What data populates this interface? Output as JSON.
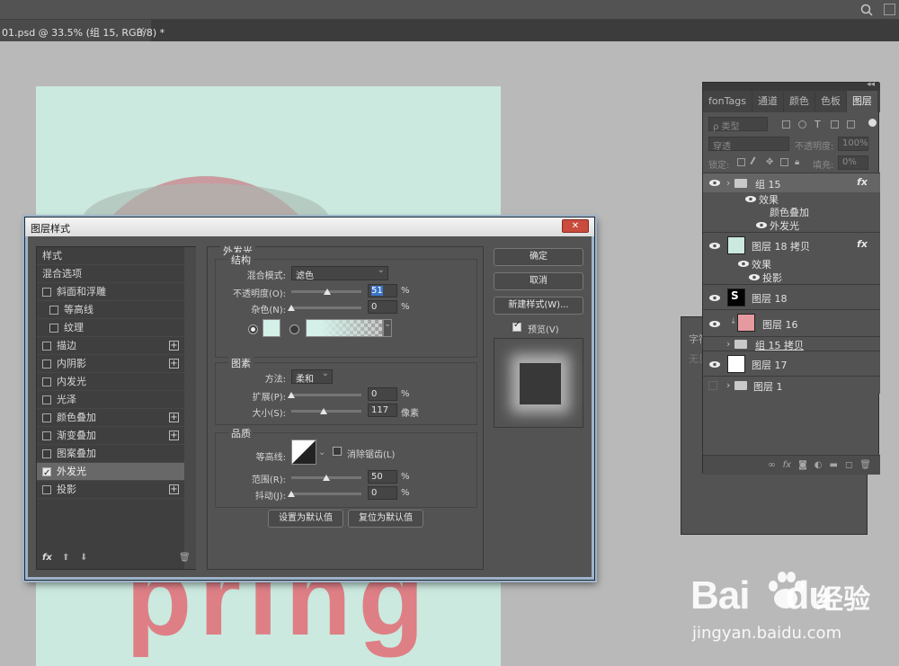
{
  "document_tab": {
    "title": "01.psd @ 33.5% (组 15, RGB/8) *",
    "close": "×"
  },
  "canvas_text": "pring",
  "layers_panel": {
    "collapse": "◂◂",
    "tabs": [
      "fonTags",
      "通道",
      "颜色",
      "色板",
      "图层"
    ],
    "active_tab": "图层",
    "filter_placeholder": "ρ 类型",
    "blend_mode": "穿透",
    "opacity_label": "不透明度:",
    "opacity_value": "100%",
    "lock_label": "锁定:",
    "fill_label": "填充:",
    "fill_value": "0%",
    "layers": [
      {
        "name": "组 15",
        "type": "group",
        "fx": "fx",
        "selected": true
      },
      {
        "name": "效果",
        "type": "effects"
      },
      {
        "name": "颜色叠加",
        "type": "effect"
      },
      {
        "name": "外发光",
        "type": "effect"
      },
      {
        "name": "图层 18 拷贝",
        "type": "layer",
        "fx": "fx"
      },
      {
        "name": "效果",
        "type": "effects"
      },
      {
        "name": "投影",
        "type": "effect"
      },
      {
        "name": "图层 18",
        "type": "layer"
      },
      {
        "name": "图层 16",
        "type": "layer"
      },
      {
        "name": "组 15 拷贝",
        "type": "group"
      },
      {
        "name": "图层 17",
        "type": "layer"
      },
      {
        "name": "图层 1",
        "type": "group"
      }
    ],
    "footer_icons": [
      "link-icon",
      "fx-icon",
      "mask-icon",
      "adjustment-icon",
      "folder-icon",
      "new-layer-icon",
      "trash-icon"
    ]
  },
  "char_panel": {
    "title": "字符",
    "text": "无贝"
  },
  "dialog": {
    "title": "图层样式",
    "styles": [
      {
        "label": "样式",
        "checkbox": false
      },
      {
        "label": "混合选项",
        "checkbox": false
      },
      {
        "label": "斜面和浮雕",
        "checkbox": true,
        "checked": false
      },
      {
        "label": "等高线",
        "checkbox": true,
        "checked": false,
        "indent": true
      },
      {
        "label": "纹理",
        "checkbox": true,
        "checked": false,
        "indent": true
      },
      {
        "label": "描边",
        "checkbox": true,
        "checked": false,
        "plus": true
      },
      {
        "label": "内阴影",
        "checkbox": true,
        "checked": false,
        "plus": true
      },
      {
        "label": "内发光",
        "checkbox": true,
        "checked": false
      },
      {
        "label": "光泽",
        "checkbox": true,
        "checked": false
      },
      {
        "label": "颜色叠加",
        "checkbox": true,
        "checked": false,
        "plus": true
      },
      {
        "label": "渐变叠加",
        "checkbox": true,
        "checked": false,
        "plus": true
      },
      {
        "label": "图案叠加",
        "checkbox": true,
        "checked": false
      },
      {
        "label": "外发光",
        "checkbox": true,
        "checked": true,
        "active": true
      },
      {
        "label": "投影",
        "checkbox": true,
        "checked": false,
        "plus": true
      }
    ],
    "section_title": "外发光",
    "structure": {
      "title": "结构",
      "blend_label": "混合模式:",
      "blend_value": "滤色",
      "opacity_label": "不透明度(O):",
      "opacity_value": "51",
      "opacity_fraction": 0.51,
      "noise_label": "杂色(N):",
      "noise_value": "0",
      "noise_fraction": 0,
      "unit": "%",
      "glow_color": "#d4f0e8"
    },
    "elements": {
      "title": "图素",
      "method_label": "方法:",
      "method_value": "柔和",
      "spread_label": "扩展(P):",
      "spread_value": "0",
      "spread_fraction": 0,
      "size_label": "大小(S):",
      "size_value": "117",
      "size_fraction": 0.46,
      "px_unit": "像素",
      "pct_unit": "%"
    },
    "quality": {
      "title": "品质",
      "contour_label": "等高线:",
      "antialias_label": "消除锯齿(L)",
      "range_label": "范围(R):",
      "range_value": "50",
      "range_fraction": 0.5,
      "jitter_label": "抖动(J):",
      "jitter_value": "0",
      "jitter_fraction": 0,
      "unit": "%"
    },
    "buttons": {
      "set_default": "设置为默认值",
      "reset_default": "复位为默认值",
      "ok": "确定",
      "cancel": "取消",
      "new_style": "新建样式(W)...",
      "preview": "预览(V)"
    },
    "fx_footer": "fx"
  },
  "watermark": {
    "logo": "Bai",
    "logo2": "du",
    "cn": "经验",
    "url": "jingyan.baidu.com"
  }
}
